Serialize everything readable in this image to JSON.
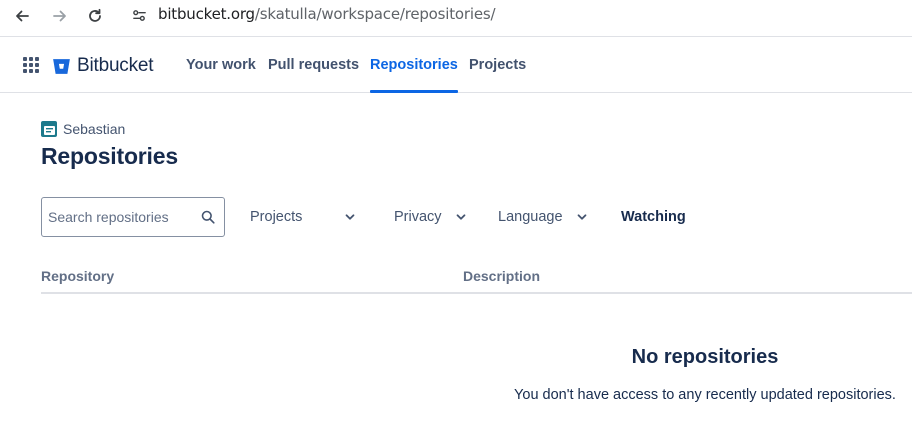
{
  "browser": {
    "url_domain": "bitbucket.org",
    "url_path": "/skatulla/workspace/repositories/"
  },
  "header": {
    "logo_text": "Bitbucket",
    "nav": [
      {
        "label": "Your work",
        "active": false
      },
      {
        "label": "Pull requests",
        "active": false
      },
      {
        "label": "Repositories",
        "active": true
      },
      {
        "label": "Projects",
        "active": false
      }
    ],
    "accent_color": "#0c66e4"
  },
  "workspace": {
    "name": "Sebastian"
  },
  "page": {
    "title": "Repositories"
  },
  "filters": {
    "search_placeholder": "Search repositories",
    "projects_label": "Projects",
    "privacy_label": "Privacy",
    "language_label": "Language",
    "watching_label": "Watching"
  },
  "table": {
    "columns": [
      "Repository",
      "Description"
    ]
  },
  "empty_state": {
    "title": "No repositories",
    "description": "You don't have access to any recently updated repositories."
  }
}
